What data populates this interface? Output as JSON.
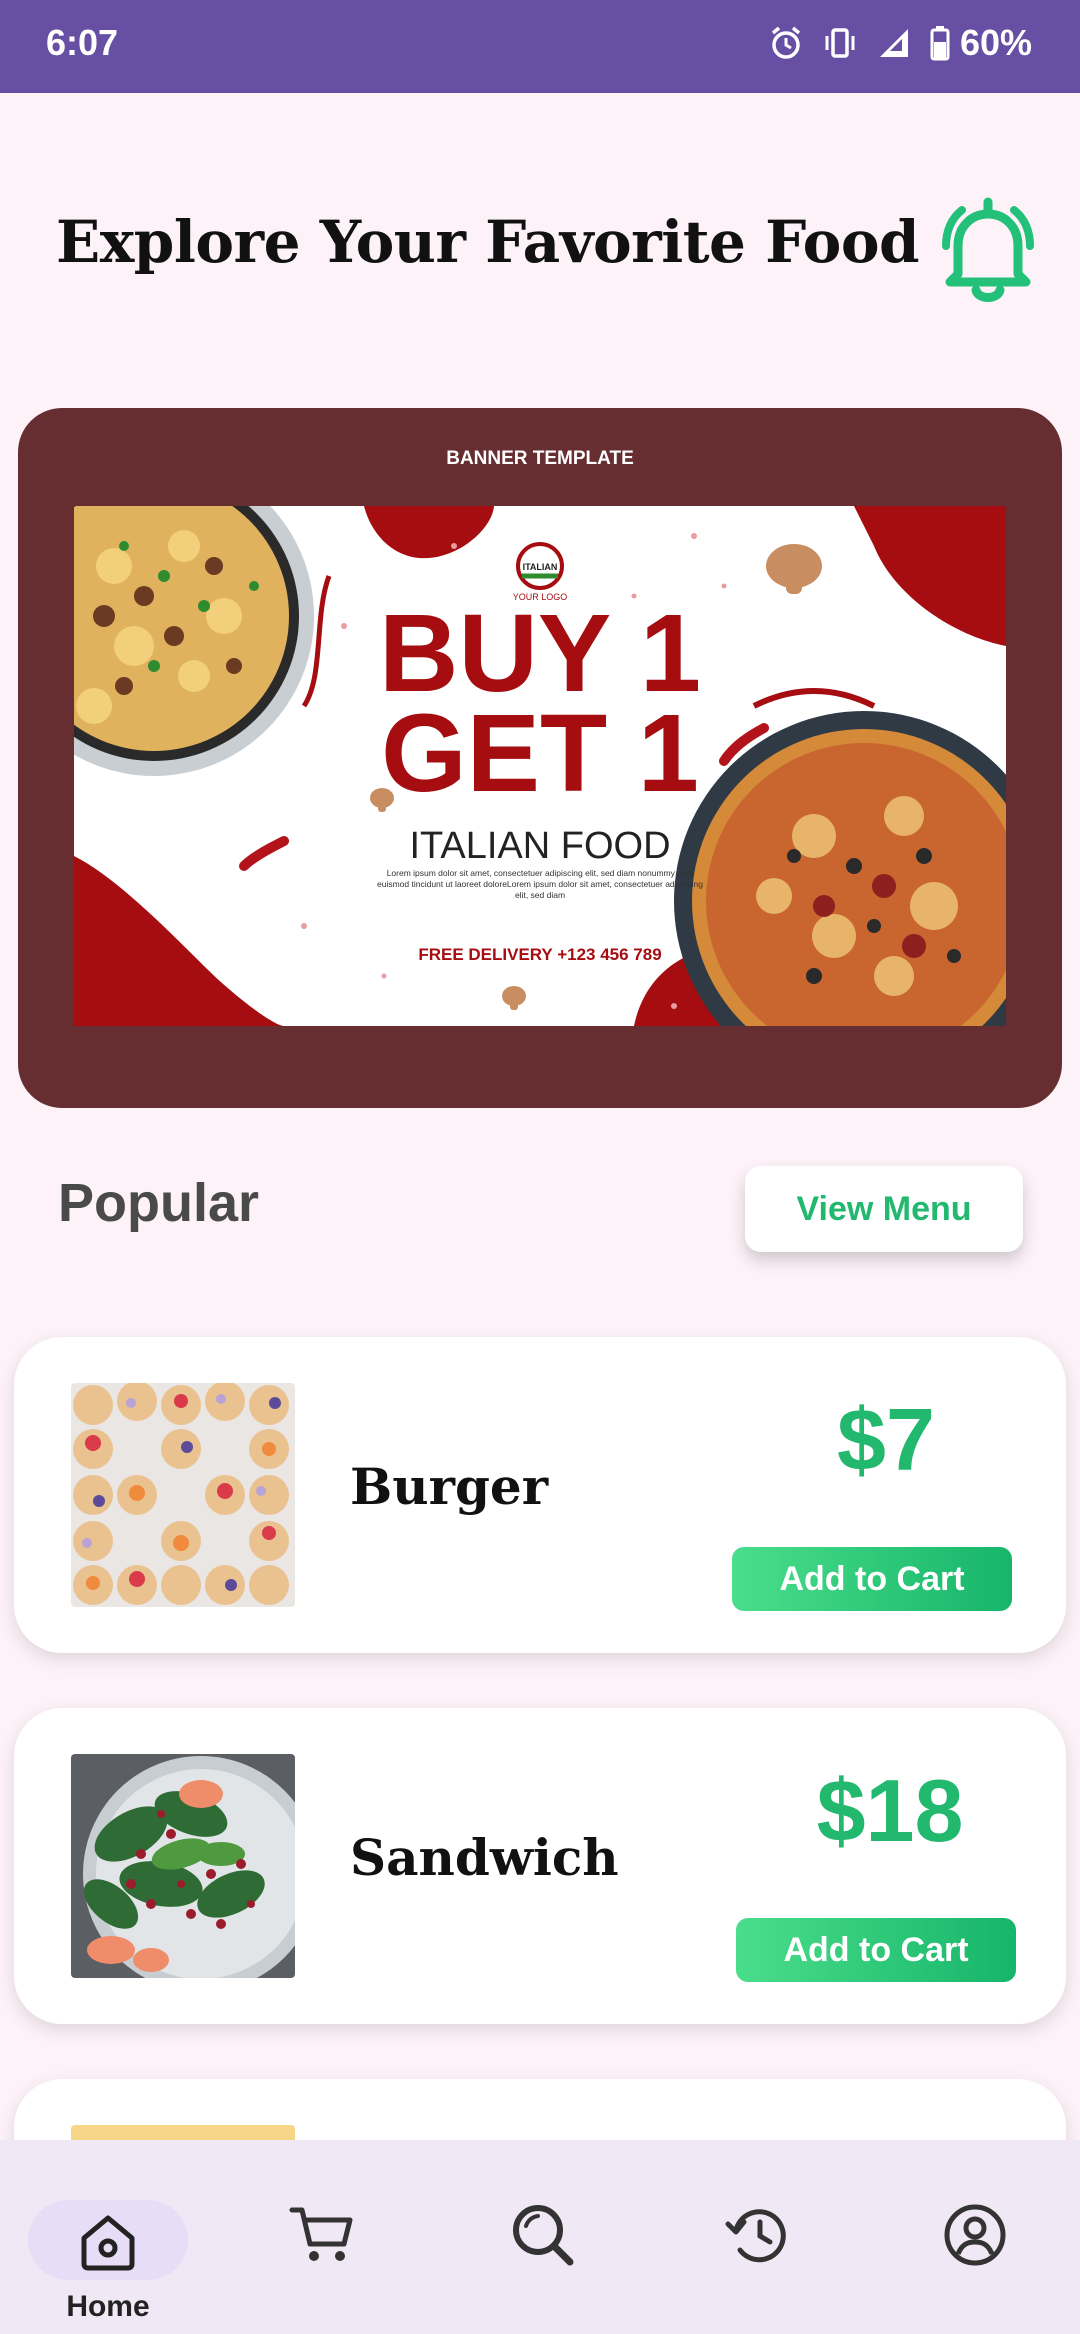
{
  "status_bar": {
    "time": "6:07",
    "battery": "60%"
  },
  "header": {
    "title": "Explore Your Favorite Food",
    "bell_icon": "bell-icon"
  },
  "banner": {
    "label": "BANNER TEMPLATE",
    "logo_text": "ITALIAN",
    "logo_sub": "YOUR LOGO",
    "headline_1": "BUY 1",
    "headline_2": "GET 1",
    "subhead": "ITALIAN FOOD",
    "body": "Lorem ipsum dolor sit amet, consectetuer adipiscing elit, sed diam nonummy nibh euismod tincidunt ut laoreet doloreLorem ipsum dolor sit amet, consectetuer adipiscing elit, sed diam",
    "delivery": "FREE DELIVERY +123 456 789"
  },
  "popular": {
    "title": "Popular",
    "view_menu_label": "View Menu"
  },
  "items": [
    {
      "name": "Burger",
      "price": "$7",
      "add_label": "Add to Cart"
    },
    {
      "name": "Sandwich",
      "price": "$18",
      "add_label": "Add to Cart"
    }
  ],
  "nav": {
    "home_label": "Home",
    "icons": [
      "home-icon",
      "cart-icon",
      "search-icon",
      "history-icon",
      "account-icon"
    ]
  },
  "colors": {
    "status_bar": "#6750a4",
    "accent_green": "#22b86e",
    "banner_bg": "#662e31",
    "banner_red": "#a50d11"
  }
}
